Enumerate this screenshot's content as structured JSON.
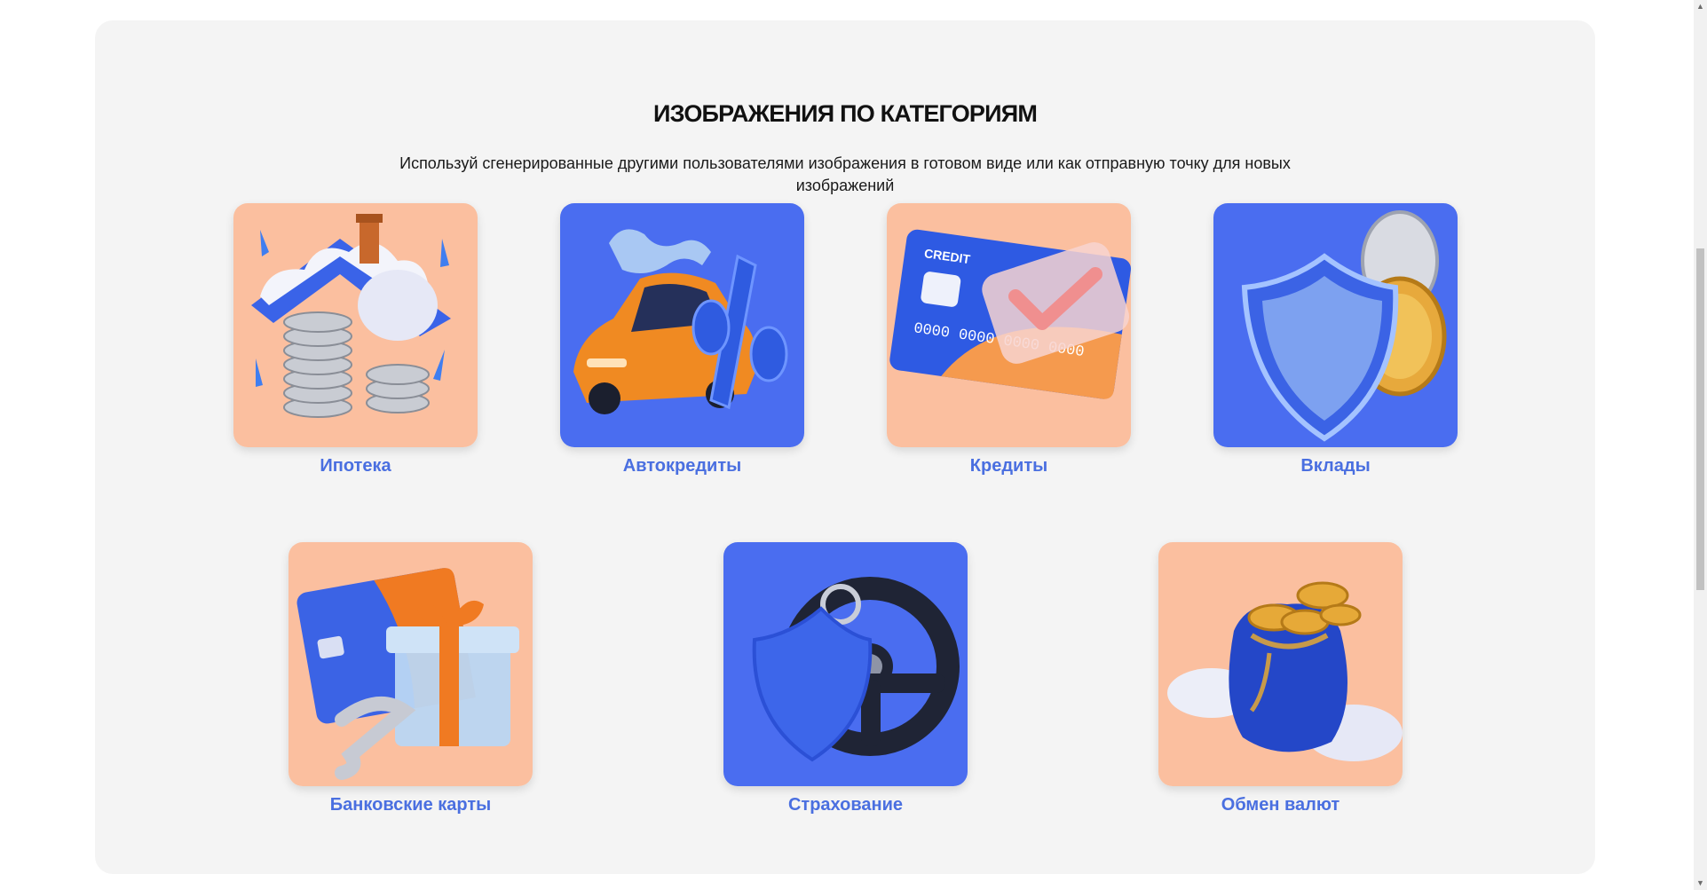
{
  "section": {
    "title": "ИЗОБРАЖЕНИЯ ПО КАТЕГОРИЯМ",
    "subtitle": "Используй сгенерированные другими пользователями изображения в готовом виде или как отправную точку для новых изображений"
  },
  "categories": [
    {
      "label": "Ипотека",
      "icon": "mortgage-house-coins-icon",
      "bg": "#fbbf9f"
    },
    {
      "label": "Автокредиты",
      "icon": "car-percent-icon",
      "bg": "#4a6df0"
    },
    {
      "label": "Кредиты",
      "icon": "credit-card-check-icon",
      "bg": "#fbbf9f"
    },
    {
      "label": "Вклады",
      "icon": "shield-coins-icon",
      "bg": "#4a6df0"
    },
    {
      "label": "Банковские карты",
      "icon": "card-gift-icon",
      "bg": "#fbbf9f"
    },
    {
      "label": "Страхование",
      "icon": "steering-wheel-shield-icon",
      "bg": "#4a6df0"
    },
    {
      "label": "Обмен валют",
      "icon": "coin-bag-icon",
      "bg": "#fbbf9f"
    }
  ],
  "card_art": {
    "credit_card_label": "CREDIT",
    "credit_card_number": "0000 0000 0000 0000"
  },
  "colors": {
    "accent": "#4a6fe0",
    "peach": "#fbbf9f",
    "blue": "#4a6df0",
    "panel": "#f4f4f4"
  }
}
